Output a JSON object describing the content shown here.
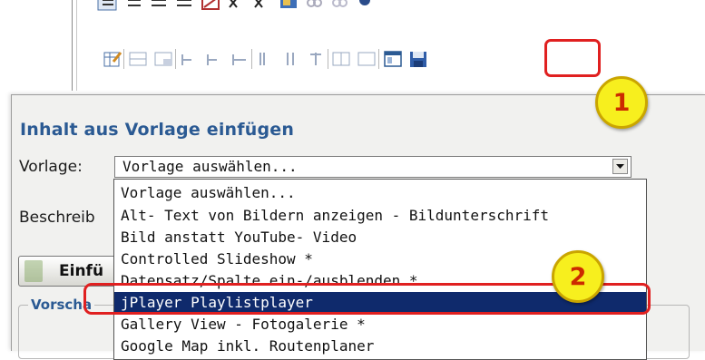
{
  "dialog": {
    "title": "Inhalt aus Vorlage einfügen",
    "vorlage_label": "Vorlage:",
    "description_label": "Beschreib",
    "select_value": "Vorlage auswählen...",
    "insert_button": "Einfü",
    "preview_legend": "Vorscha"
  },
  "dropdown": {
    "options": [
      "Vorlage auswählen...",
      "Alt- Text von Bildern anzeigen - Bildunterschrift",
      "Bild anstatt YouTube- Video",
      "Controlled Slideshow *",
      "Datensatz/Spalte ein-/ausblenden *",
      "jPlayer Playlistplayer",
      "Gallery View - Fotogalerie *",
      "Google Map inkl. Routenplaner"
    ],
    "selected_option": "jPlayer Playlistplayer"
  },
  "callouts": {
    "step1": "1",
    "step2": "2"
  },
  "colors": {
    "title": "#2b5a93",
    "selection": "#0f2a6c",
    "callout_fill": "#f7ef1e",
    "highlight": "#e02020"
  }
}
